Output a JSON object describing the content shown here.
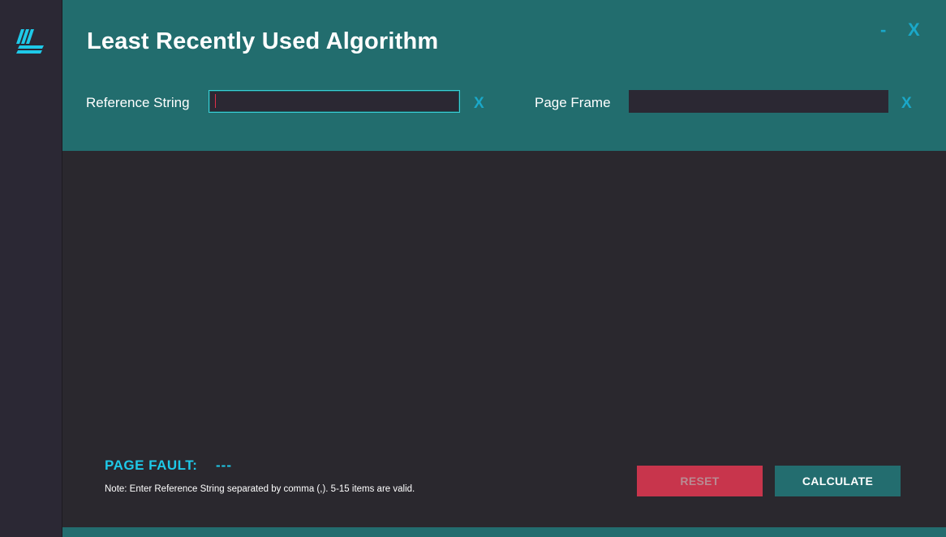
{
  "app": {
    "title": "Least Recently Used Algorithm",
    "minimize_label": "-",
    "close_label": "X"
  },
  "inputs": {
    "reference_string": {
      "label": "Reference String",
      "value": "",
      "clear_label": "X"
    },
    "page_frame": {
      "label": "Page Frame",
      "value": "",
      "clear_label": "X"
    }
  },
  "result": {
    "page_fault_label": "PAGE FAULT:",
    "page_fault_value": "---",
    "note": "Note: Enter Reference String separated by comma (,). 5-15 items are valid."
  },
  "buttons": {
    "reset_label": "RESET",
    "calculate_label": "CALCULATE"
  },
  "colors": {
    "header_bg": "#226d6e",
    "accent_cyan": "#1ec9e8",
    "reset_bg": "#c8354c",
    "calculate_bg": "#236d6f"
  },
  "icons": {
    "logo": "app-logo-icon"
  }
}
